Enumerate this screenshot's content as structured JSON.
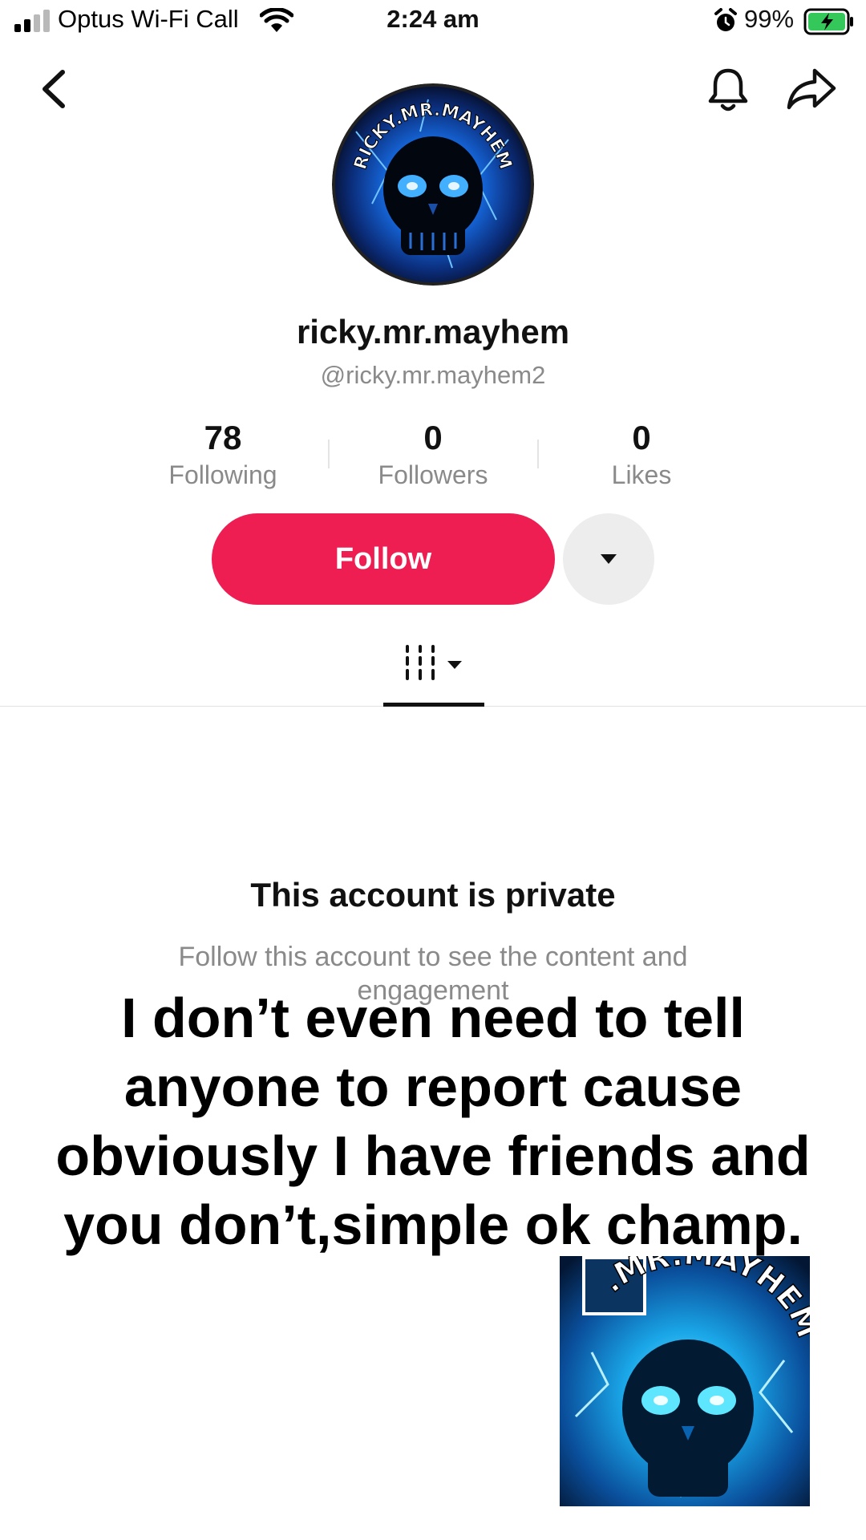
{
  "status_bar": {
    "carrier": "Optus Wi-Fi Call",
    "time": "2:24 am",
    "battery_percent": "99%"
  },
  "profile": {
    "avatar_text": "RICKY.MR.MAYHEM",
    "display_name": "ricky.mr.mayhem",
    "handle": "@ricky.mr.mayhem2"
  },
  "stats": [
    {
      "value": "78",
      "label": "Following"
    },
    {
      "value": "0",
      "label": "Followers"
    },
    {
      "value": "0",
      "label": "Likes"
    }
  ],
  "actions": {
    "follow_label": "Follow"
  },
  "private_notice": {
    "title": "This account is private",
    "subtitle": "Follow this account to see the content and engagement"
  },
  "overlay_caption": "I don’t even need to tell anyone to report cause obviously I have friends and you don’t,simple ok champ.",
  "thumbnail": {
    "text": ".MR.MAYHEM"
  },
  "colors": {
    "follow_button": "#ee1d52",
    "battery_green": "#34c759",
    "skull_blue": "#1e88ff"
  },
  "icons": [
    "signal-icon",
    "wifi-icon",
    "alarm-icon",
    "battery-icon",
    "back-icon",
    "bell-icon",
    "share-icon",
    "chevron-down-icon",
    "grid-icon"
  ]
}
